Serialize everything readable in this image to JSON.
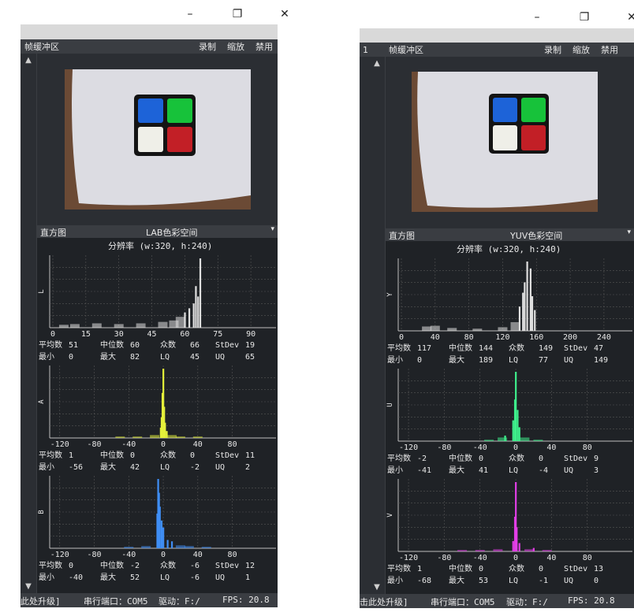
{
  "window_controls": {
    "minimize": "–",
    "maximize": "❐",
    "close": "✕"
  },
  "left": {
    "title": "帧缓冲区",
    "actions": [
      "录制",
      "缩放",
      "禁用"
    ],
    "histogram_label": "直方图",
    "color_space": "LAB色彩空间",
    "dropdown": "▾",
    "resolution": "分辨率 (w:320, h:240)",
    "status": {
      "upgrade": "此处升级]",
      "port": "串行端口：COM5",
      "drive": "驱动：F:/",
      "fps": "FPS:  20.8"
    },
    "channels": [
      {
        "name": "L",
        "color": "#e0e0e0",
        "ticks": [
          0,
          15,
          30,
          45,
          60,
          75,
          90
        ],
        "range": [
          0,
          100
        ],
        "spikes": [
          [
            67,
            1.0
          ],
          [
            65,
            0.6
          ],
          [
            66,
            0.45
          ],
          [
            64,
            0.35
          ],
          [
            62,
            0.28
          ],
          [
            60,
            0.22
          ]
        ],
        "base": [
          [
            5,
            0.04
          ],
          [
            10,
            0.05
          ],
          [
            20,
            0.06
          ],
          [
            30,
            0.05
          ],
          [
            40,
            0.06
          ],
          [
            50,
            0.08
          ],
          [
            55,
            0.1
          ],
          [
            58,
            0.15
          ]
        ],
        "stats": {
          "mean": "51",
          "median": "60",
          "mode": "66",
          "stdev": "19",
          "min": "0",
          "max": "82",
          "lq": "45",
          "uq": "65"
        }
      },
      {
        "name": "A",
        "color": "#e4f03a",
        "ticks": [
          -120,
          -80,
          -40,
          0,
          40,
          80
        ],
        "range": [
          -128,
          127
        ],
        "spikes": [
          [
            0,
            1.0
          ],
          [
            -1,
            0.65
          ],
          [
            1,
            0.45
          ],
          [
            -2,
            0.3
          ],
          [
            2,
            0.22
          ],
          [
            -3,
            0.15
          ],
          [
            4,
            0.1
          ]
        ],
        "base": [
          [
            -50,
            0.02
          ],
          [
            -30,
            0.02
          ],
          [
            -10,
            0.04
          ],
          [
            10,
            0.04
          ],
          [
            20,
            0.02
          ],
          [
            40,
            0.02
          ]
        ],
        "stats": {
          "mean": "1",
          "median": "0",
          "mode": "0",
          "stdev": "11",
          "min": "-56",
          "max": "42",
          "lq": "-2",
          "uq": "2"
        }
      },
      {
        "name": "B",
        "color": "#3f8ef5",
        "ticks": [
          -120,
          -80,
          -40,
          0,
          40,
          80
        ],
        "range": [
          -128,
          127
        ],
        "spikes": [
          [
            -6,
            1.0
          ],
          [
            -5,
            0.8
          ],
          [
            -4,
            0.6
          ],
          [
            -7,
            0.5
          ],
          [
            -2,
            0.4
          ],
          [
            0,
            0.3
          ],
          [
            5,
            0.12
          ],
          [
            10,
            0.1
          ]
        ],
        "base": [
          [
            -40,
            0.02
          ],
          [
            -20,
            0.03
          ],
          [
            20,
            0.04
          ],
          [
            30,
            0.03
          ],
          [
            50,
            0.02
          ]
        ],
        "stats": {
          "mean": "0",
          "median": "-2",
          "mode": "-6",
          "stdev": "12",
          "min": "-40",
          "max": "52",
          "lq": "-6",
          "uq": "1"
        }
      }
    ]
  },
  "right": {
    "line_number": "1",
    "title": "帧缓冲区",
    "actions": [
      "录制",
      "缩放",
      "禁用"
    ],
    "histogram_label": "直方图",
    "color_space": "YUV色彩空间",
    "dropdown": "▾",
    "resolution": "分辨率 (w:320, h:240)",
    "status": {
      "upgrade": "击此处升级]",
      "port": "串行端口：COM5",
      "drive": "驱动：F:/",
      "fps": "FPS:  20.8"
    },
    "channels": [
      {
        "name": "Y",
        "color": "#e0e0e0",
        "ticks": [
          0,
          40,
          80,
          120,
          160,
          200,
          240
        ],
        "range": [
          0,
          270
        ],
        "spikes": [
          [
            149,
            1.0
          ],
          [
            153,
            0.9
          ],
          [
            146,
            0.7
          ],
          [
            144,
            0.55
          ],
          [
            155,
            0.5
          ],
          [
            140,
            0.35
          ],
          [
            158,
            0.3
          ]
        ],
        "base": [
          [
            30,
            0.06
          ],
          [
            40,
            0.07
          ],
          [
            60,
            0.04
          ],
          [
            90,
            0.03
          ],
          [
            120,
            0.05
          ],
          [
            135,
            0.12
          ]
        ],
        "stats": {
          "mean": "117",
          "median": "144",
          "mode": "149",
          "stdev": "47",
          "min": "0",
          "max": "189",
          "lq": "77",
          "uq": "149"
        }
      },
      {
        "name": "U",
        "color": "#3ef08c",
        "ticks": [
          -120,
          -80,
          -40,
          0,
          40,
          80
        ],
        "range": [
          -128,
          127
        ],
        "spikes": [
          [
            0,
            1.0
          ],
          [
            -1,
            0.6
          ],
          [
            2,
            0.45
          ],
          [
            -3,
            0.3
          ],
          [
            4,
            0.2
          ],
          [
            -12,
            0.08
          ]
        ],
        "base": [
          [
            -30,
            0.02
          ],
          [
            -15,
            0.05
          ],
          [
            10,
            0.05
          ],
          [
            25,
            0.02
          ]
        ],
        "stats": {
          "mean": "-2",
          "median": "0",
          "mode": "0",
          "stdev": "9",
          "min": "-41",
          "max": "41",
          "lq": "-4",
          "uq": "3"
        }
      },
      {
        "name": "V",
        "color": "#e23ee6",
        "ticks": [
          -120,
          -80,
          -40,
          0,
          40,
          80
        ],
        "range": [
          -128,
          127
        ],
        "spikes": [
          [
            0,
            1.0
          ],
          [
            -1,
            0.5
          ],
          [
            1,
            0.35
          ],
          [
            -3,
            0.15
          ],
          [
            4,
            0.12
          ],
          [
            20,
            0.05
          ]
        ],
        "base": [
          [
            -60,
            0.02
          ],
          [
            -40,
            0.02
          ],
          [
            -20,
            0.03
          ],
          [
            15,
            0.03
          ],
          [
            35,
            0.02
          ]
        ],
        "stats": {
          "mean": "1",
          "median": "0",
          "mode": "0",
          "stdev": "13",
          "min": "-68",
          "max": "53",
          "lq": "-1",
          "uq": "0"
        }
      }
    ]
  },
  "stat_labels": {
    "mean": "平均数",
    "median": "中位数",
    "mode": "众数",
    "stdev": "StDev",
    "min": "最小",
    "max": "最大",
    "lq": "LQ",
    "uq": "UQ"
  }
}
